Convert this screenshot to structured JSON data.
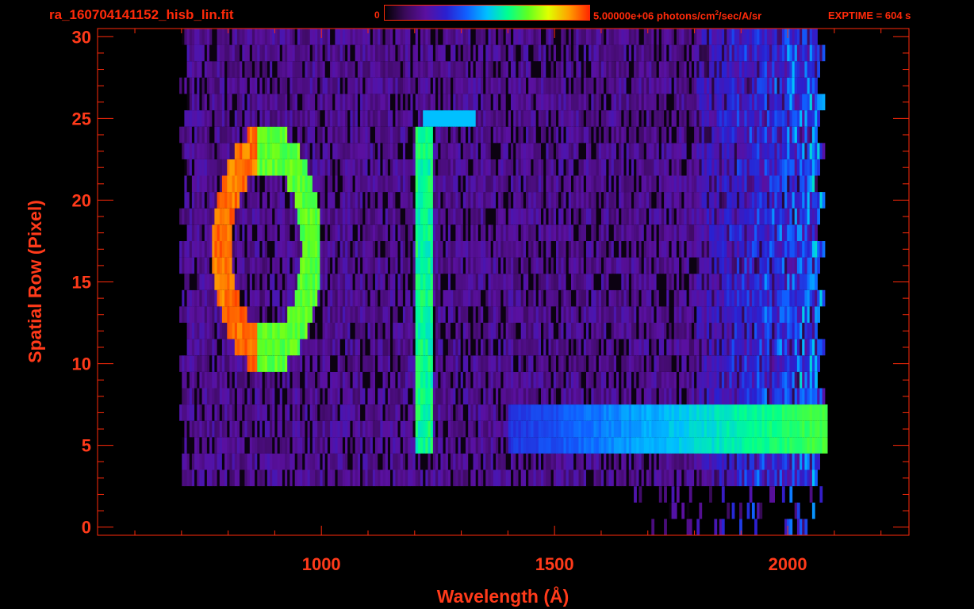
{
  "header": {
    "filename": "ra_160704141152_hisb_lin.fit",
    "colorbar_min": "0",
    "colorbar_max_value": "5.00000e+06",
    "colorbar_units_pre": "photons/cm",
    "colorbar_units_sup": "2",
    "colorbar_units_post": "/sec/A/sr",
    "exptime": "EXPTIME = 604 s"
  },
  "colors": {
    "axis": "#ff2a0a",
    "background": "#000000",
    "colormap": [
      "#000000",
      "#3a0a5a",
      "#5a10a0",
      "#2a20d0",
      "#1060ff",
      "#00c0ff",
      "#00ff90",
      "#60ff20",
      "#e0ff00",
      "#ffa000",
      "#ff2800"
    ]
  },
  "chart_data": {
    "type": "heatmap",
    "title": "ra_160704141152_hisb_lin.fit",
    "xlabel": "Wavelength (Å)",
    "ylabel": "Spatial Row (Pixel)",
    "xlim": [
      520,
      2260
    ],
    "ylim": [
      -0.5,
      30.5
    ],
    "x_ticks": [
      1000,
      1500,
      2000
    ],
    "y_ticks": [
      0,
      5,
      10,
      15,
      20,
      25,
      30
    ],
    "x_tick_labels": [
      "1000",
      "1500",
      "2000"
    ],
    "y_tick_labels": [
      "0",
      "5",
      "10",
      "15",
      "20",
      "25",
      "30"
    ],
    "colorbar_range": [
      0,
      5000000
    ],
    "colorbar_units": "photons/cm²/sec/A/sr",
    "grid": false,
    "features": [
      {
        "description": "bright ring",
        "center_wavelength": 880,
        "center_row": 17,
        "intensity": "high"
      },
      {
        "description": "vertical line",
        "wavelength": 1216,
        "rows": [
          5,
          24
        ],
        "intensity": "medium"
      },
      {
        "description": "horizontal band",
        "wavelength_range": [
          1400,
          2080
        ],
        "rows": [
          5,
          7
        ],
        "intensity": "medium"
      }
    ]
  }
}
